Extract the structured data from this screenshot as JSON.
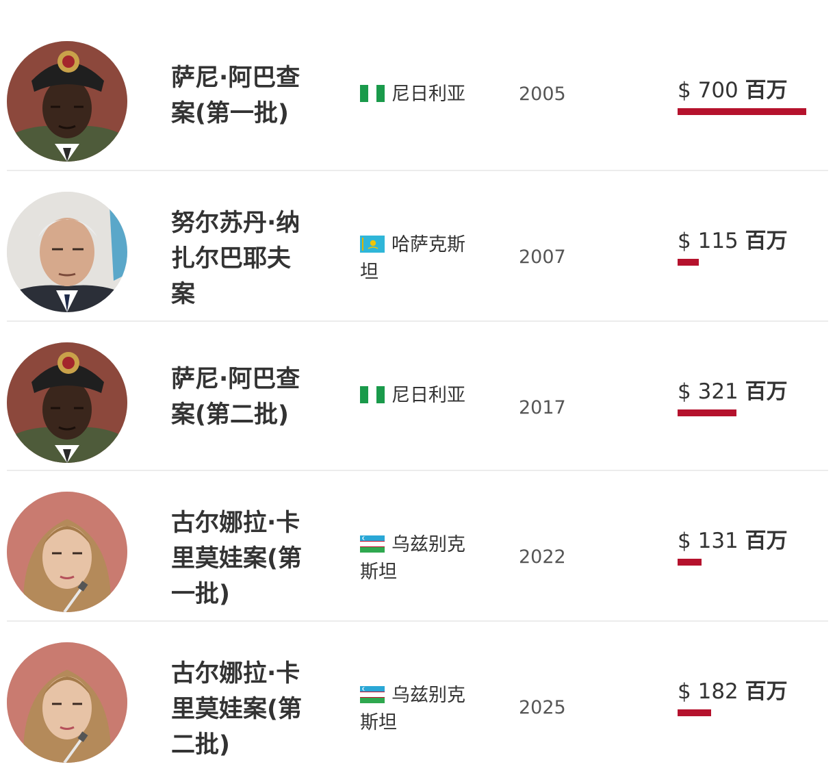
{
  "colors": {
    "bar": "#b5122d",
    "divider": "#ececec"
  },
  "chart_data": {
    "type": "bar",
    "title": "",
    "xlabel": "",
    "ylabel": "",
    "ylim": [
      0,
      700
    ],
    "categories": [
      "萨尼·阿巴查案(第一批)",
      "努尔苏丹·纳扎尔巴耶夫案",
      "萨尼·阿巴查案(第二批)",
      "古尔娜拉·卡里莫娃案(第一批)",
      "古尔娜拉·卡里莫娃案(第二批)"
    ],
    "values": [
      700,
      115,
      321,
      131,
      182
    ],
    "rows": [
      {
        "name": "萨尼·阿巴查案(第一批)",
        "country": "尼日利亚",
        "flag": "nigeria-flag-icon",
        "year": "2005",
        "currency": "$",
        "value": 700,
        "value_text": "700",
        "unit": "百万",
        "portrait": "portrait-man-military-cap"
      },
      {
        "name": "努尔苏丹·纳扎尔巴耶夫案",
        "country": "哈萨克斯坦",
        "flag": "kazakhstan-flag-icon",
        "year": "2007",
        "currency": "$",
        "value": 115,
        "value_text": "115",
        "unit": "百万",
        "portrait": "portrait-man-white-hair"
      },
      {
        "name": "萨尼·阿巴查案(第二批)",
        "country": "尼日利亚",
        "flag": "nigeria-flag-icon",
        "year": "2017",
        "currency": "$",
        "value": 321,
        "value_text": "321",
        "unit": "百万",
        "portrait": "portrait-man-military-cap"
      },
      {
        "name": "古尔娜拉·卡里莫娃案(第一批)",
        "country": "乌兹别克斯坦",
        "flag": "uzbekistan-flag-icon",
        "year": "2022",
        "currency": "$",
        "value": 131,
        "value_text": "131",
        "unit": "百万",
        "portrait": "portrait-woman-microphone"
      },
      {
        "name": "古尔娜拉·卡里莫娃案(第二批)",
        "country": "乌兹别克斯坦",
        "flag": "uzbekistan-flag-icon",
        "year": "2025",
        "currency": "$",
        "value": 182,
        "value_text": "182",
        "unit": "百万",
        "portrait": "portrait-woman-microphone"
      }
    ]
  }
}
